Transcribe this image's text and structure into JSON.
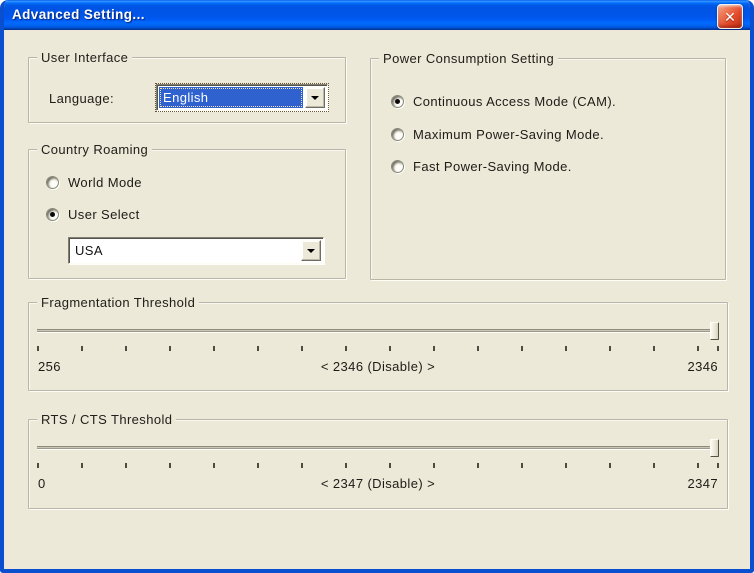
{
  "window": {
    "title": "Advanced Setting...",
    "icons": {
      "close": "✕",
      "dropdown_arrow": "css-triangle-down"
    }
  },
  "colors": {
    "titlebar_blue": "#0054E3",
    "window_border": "#0A4FD0",
    "client_bg": "#ECE9D8",
    "selection_blue": "#2F62CE"
  },
  "user_interface": {
    "legend": "User Interface",
    "language_label": "Language:",
    "language": {
      "value": "English",
      "focused": true
    }
  },
  "country_roaming": {
    "legend": "Country Roaming",
    "options": [
      {
        "label": "World Mode",
        "selected": false
      },
      {
        "label": "User Select",
        "selected": true
      }
    ],
    "country": {
      "value": "USA"
    }
  },
  "power_setting": {
    "legend": "Power Consumption Setting",
    "options": [
      {
        "label": "Continuous Access Mode (CAM).",
        "selected": true
      },
      {
        "label": "Maximum Power-Saving Mode.",
        "selected": false
      },
      {
        "label": "Fast Power-Saving Mode.",
        "selected": false
      }
    ]
  },
  "sliders": {
    "fragmentation": {
      "legend": "Fragmentation Threshold",
      "min_label": "256",
      "value_label": "< 2346 (Disable) >",
      "max_label": "2346",
      "thumb_percent": 100,
      "tick_count": 16
    },
    "rts_cts": {
      "legend": "RTS / CTS Threshold",
      "min_label": "0",
      "value_label": "< 2347 (Disable) >",
      "max_label": "2347",
      "thumb_percent": 100,
      "tick_count": 16
    }
  }
}
